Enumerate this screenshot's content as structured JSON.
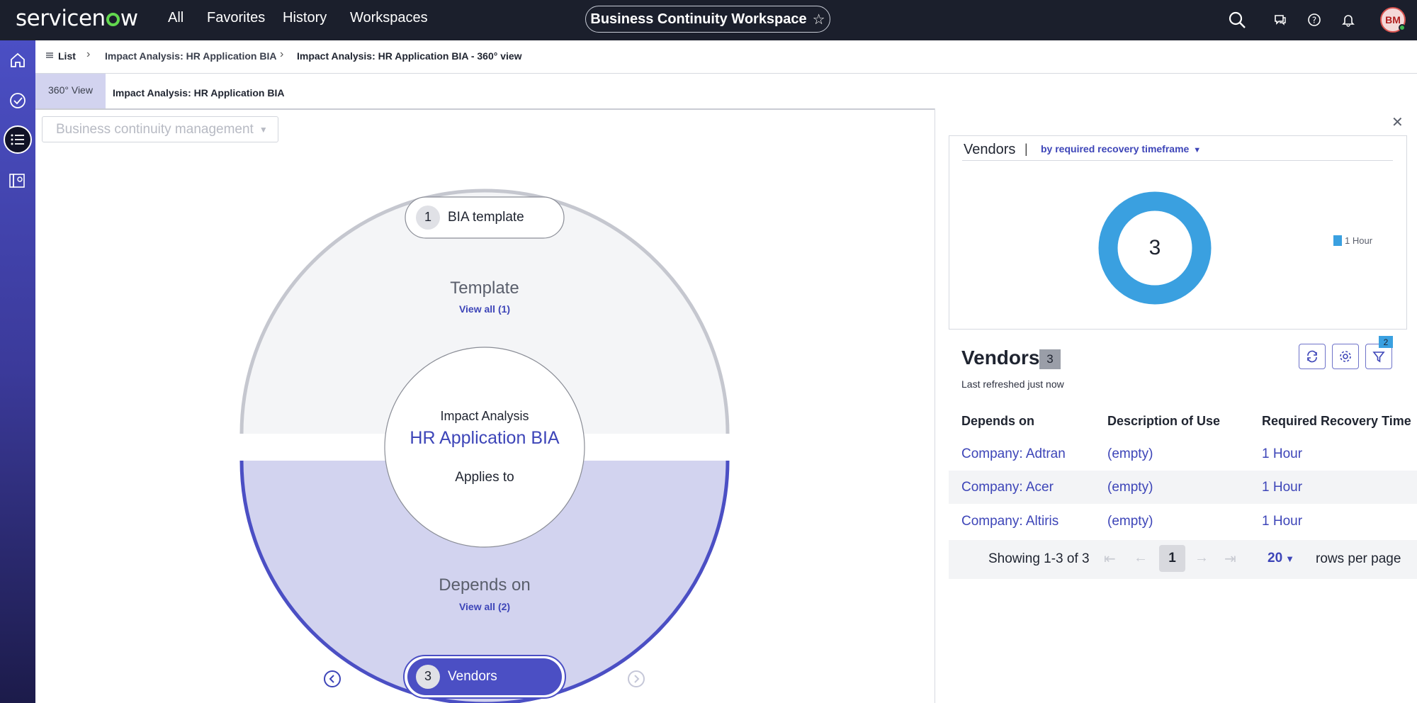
{
  "topbar": {
    "logo_text": "servicenow",
    "nav": [
      "All",
      "Favorites",
      "History",
      "Workspaces"
    ],
    "workspace_title": "Business Continuity Workspace",
    "avatar_initials": "BM"
  },
  "breadcrumb": {
    "list_label": "List",
    "parent": "Impact Analysis: HR Application BIA",
    "current": "Impact Analysis: HR Application BIA - 360° view"
  },
  "tabs": {
    "view_tab": "360° View",
    "record_tab": "Impact Analysis: HR Application BIA"
  },
  "canvas": {
    "filter_select": "Business continuity management",
    "top_node": {
      "number": "1",
      "label": "BIA template"
    },
    "top_section": {
      "title": "Template",
      "link": "View all (1)"
    },
    "center": {
      "type": "Impact Analysis",
      "name": "HR Application BIA",
      "relation": "Applies to"
    },
    "bottom_section": {
      "title": "Depends on",
      "link": "View all (2)"
    },
    "bottom_node": {
      "number": "3",
      "label": "Vendors"
    }
  },
  "panel": {
    "chart_title": "Vendors",
    "chart_group_by": "by required recovery timeframe",
    "chart_center_value": "3",
    "legend_label": "1 Hour",
    "list_title": "Vendors",
    "count": "3",
    "refreshed": "Last refreshed just now",
    "filter_count": "2",
    "columns": [
      "Depends on",
      "Description of Use",
      "Required Recovery Time"
    ],
    "rows": [
      {
        "depends_on": "Company: Adtran",
        "description": "(empty)",
        "recovery": "1 Hour"
      },
      {
        "depends_on": "Company: Acer",
        "description": "(empty)",
        "recovery": "1 Hour"
      },
      {
        "depends_on": "Company: Altiris",
        "description": "(empty)",
        "recovery": "1 Hour"
      }
    ],
    "pager": {
      "showing": "Showing 1-3 of 3",
      "page": "1",
      "page_size": "20",
      "rows_label": "rows per page"
    }
  },
  "colors": {
    "accent": "#3d45b8",
    "donut": "#3aa0e0",
    "lower_fill": "#d2d3ef",
    "upper_fill": "#f4f5f7"
  },
  "chart_data": {
    "type": "pie",
    "categories": [
      "1 Hour"
    ],
    "values": [
      3
    ],
    "title": "Vendors",
    "subtitle": "by required recovery timeframe",
    "legend": "right"
  }
}
